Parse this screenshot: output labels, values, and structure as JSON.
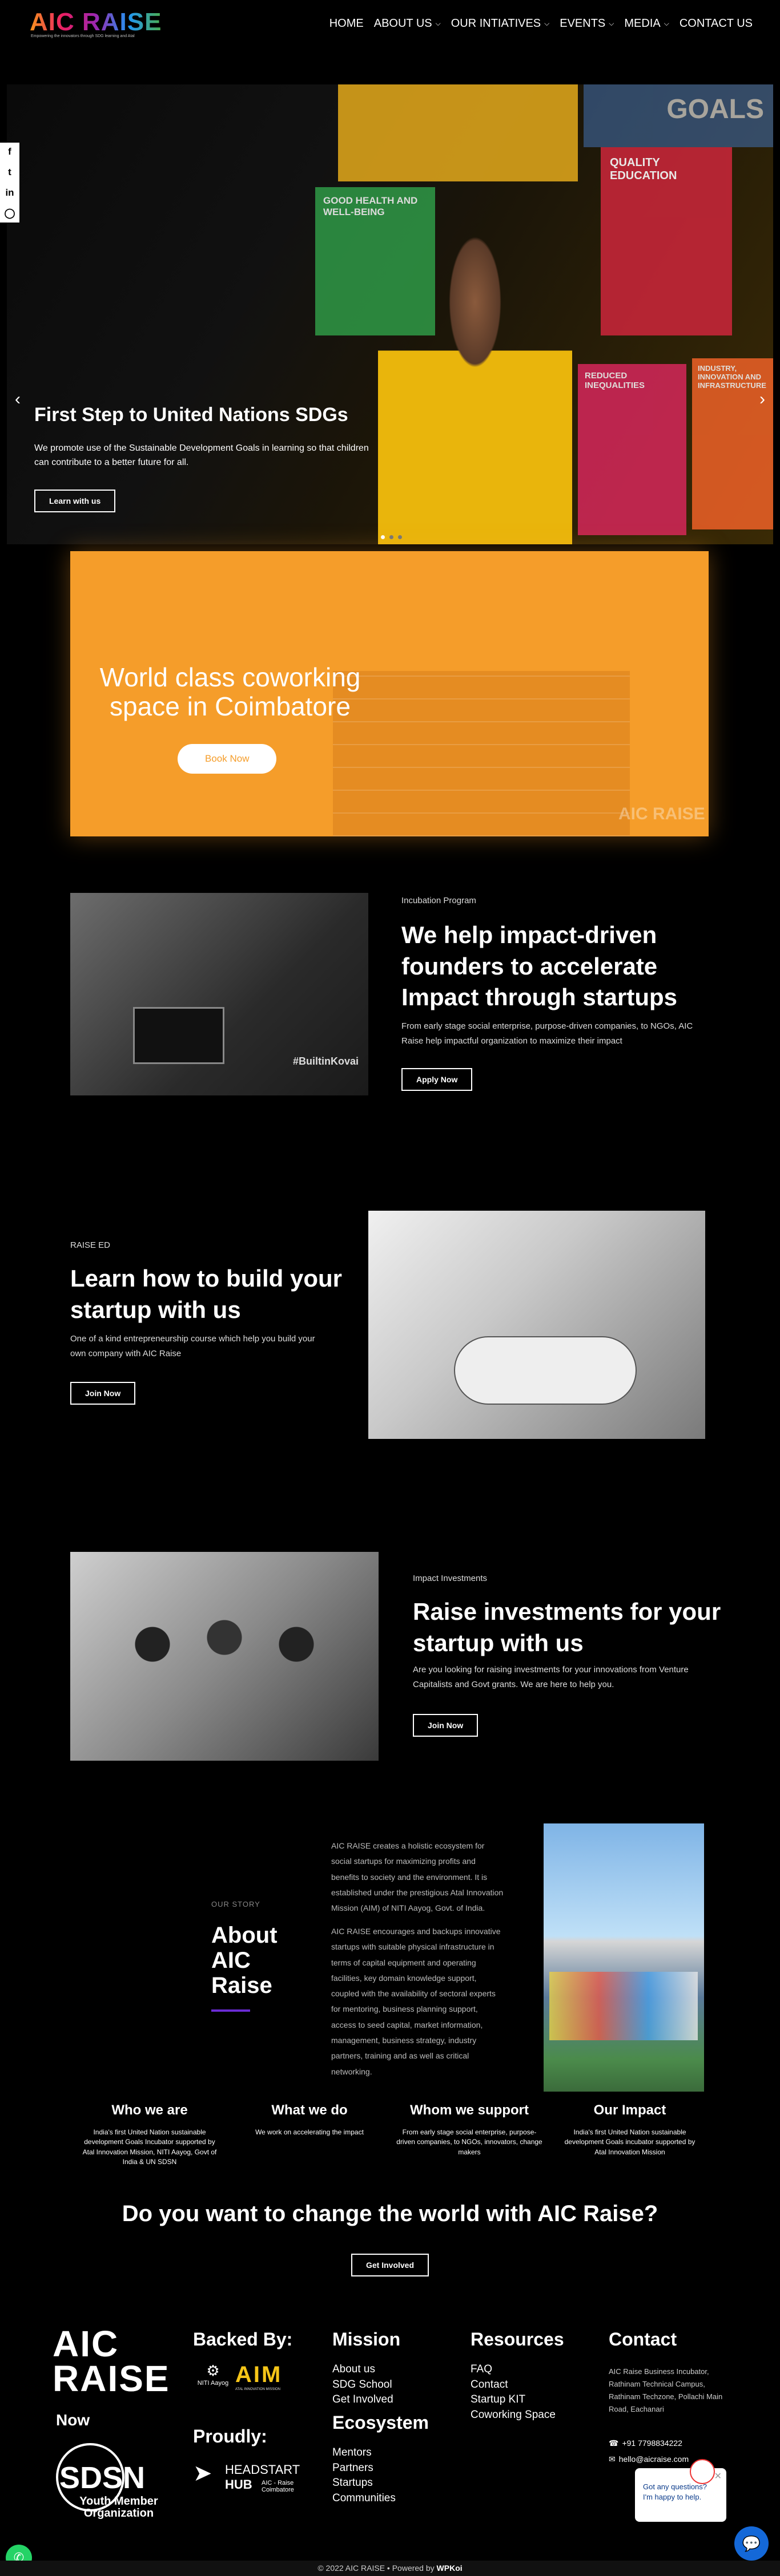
{
  "header": {
    "logo": "AIC RAISE",
    "logo_tagline": "Empowering the innovators through SDG learning and Atal",
    "nav": [
      "HOME",
      "ABOUT US",
      "OUR INTIATIVES",
      "EVENTS",
      "MEDIA",
      "CONTACT US"
    ]
  },
  "hero": {
    "title": "First Step to United Nations SDGs",
    "description": "We promote use of the Sustainable Development Goals in learning so that children can contribute to a better future for all.",
    "button": "Learn with us",
    "cube_labels": [
      "GOOD HEALTH AND WELL-BEING",
      "QUALITY EDUCATION",
      "REDUCED INEQUALITIES",
      "INDUSTRY, INNOVATION AND INFRASTRUCTURE",
      "GOALS"
    ]
  },
  "cowork": {
    "title": "World class coworking space in Coimbatore",
    "button": "Book Now",
    "watermark": "AIC RAISE"
  },
  "incubation": {
    "eyebrow": "Incubation Program",
    "title": "We help impact-driven founders to accelerate Impact through startups",
    "description": "From early stage social enterprise, purpose-driven companies, to NGOs, AIC Raise help impactful organization to maximize their impact",
    "button": "Apply Now",
    "photo_text": "#BuiltinKovai"
  },
  "raise_ed": {
    "eyebrow": "RAISE ED",
    "title": "Learn how to build your startup with us",
    "description": "One of a kind entrepreneurship course which help you build your own company with AIC Raise",
    "button": "Join Now"
  },
  "investments": {
    "eyebrow": "Impact Investments",
    "title": "Raise investments for your startup with us",
    "description": "Are you looking for raising investments for your innovations from Venture Capitalists and Govt grants. We are here to help you.",
    "button": "Join Now"
  },
  "story": {
    "eyebrow": "OUR STORY",
    "title": "About AIC Raise",
    "para1": "AIC RAISE creates a holistic ecosystem for social startups for maximizing profits and benefits to society and the environment. It is established under the prestigious Atal Innovation Mission (AIM) of NITI Aayog, Govt. of India.",
    "para2": "AIC RAISE encourages and backups innovative startups with suitable physical infrastructure in terms of capital equipment and operating facilities, key domain knowledge support, coupled with the availability of sectoral experts for mentoring, business planning support, access to seed capital, market information, management, business strategy, industry partners, training and as well as critical networking."
  },
  "who": [
    {
      "title": "Who we are",
      "text": "India's first United Nation sustainable development Goals Incubator supported by Atal Innovation Mission, NITI Aayog, Govt of India & UN SDSN"
    },
    {
      "title": "What we do",
      "text": "We work on accelerating the impact"
    },
    {
      "title": "Whom we support",
      "text": "From early stage social enterprise, purpose-driven companies, to NGOs, innovators, change makers"
    },
    {
      "title": "Our Impact",
      "text": "India's first United Nation sustainable development Goals incubator supported by Atal Innovation Mission"
    }
  ],
  "cta": {
    "title": "Do you want to change the world with AIC Raise?",
    "button": "Get Involved"
  },
  "footer": {
    "logo": "AIC RAISE",
    "now": "Now",
    "sdsn_title": "SDSN",
    "sdsn_sub": "Youth Member Organization",
    "backed_by": "Backed By:",
    "niti": "NITI Aayog",
    "aim": "AIM",
    "aim_sub": "ATAL INNOVATION MISSION",
    "proudly": "Proudly:",
    "headstart_title": "HEADSTART",
    "headstart_hub": "HUB",
    "headstart_sub": "AIC - Raise Coimbatore",
    "mission_title": "Mission",
    "mission_links": [
      "About us",
      "SDG School",
      "Get Involved"
    ],
    "ecosystem_title": "Ecosystem",
    "ecosystem_links": [
      "Mentors",
      "Partners",
      "Startups",
      "Communities"
    ],
    "resources_title": "Resources",
    "resources_links": [
      "FAQ",
      "Contact",
      "Startup KIT",
      "Coworking Space"
    ],
    "contact_title": "Contact",
    "address": "AIC Raise Business Incubator, Rathinam Technical Campus, Rathinam Techzone, Pollachi Main Road, Eachanari",
    "phone": "+91 7798834222",
    "email": "hello@aicraise.com",
    "copyright": "© 2022 AIC RAISE • Powered by",
    "powered_by": "WPKoi"
  },
  "chat": {
    "message": "Got any questions? I'm happy to help."
  }
}
